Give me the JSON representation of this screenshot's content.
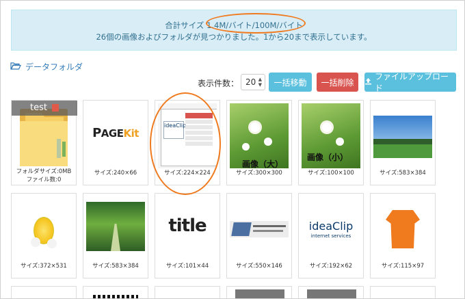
{
  "info": {
    "line1_prefix": "合計サイズ ",
    "line1_value": "1.4M/バイト/100M/バイト",
    "line2": "26個の画像およびフォルダが見つかりました。1から20まで表示しています。"
  },
  "breadcrumb": {
    "label": "データフォルダ"
  },
  "controls": {
    "page_size_label": "表示件数：",
    "page_size_value": "20",
    "move_button": "一括移動",
    "delete_button": "一括削除",
    "upload_button": "ファイルアップロード"
  },
  "colors": {
    "accent": "#5bc0de",
    "danger": "#d9534f",
    "highlight": "#f07a1e",
    "info_bg": "#d9edf7"
  },
  "folder": {
    "name": "test",
    "size_caption": "フォルダサイズ:0MB",
    "count_caption": "ファイル数:0"
  },
  "tiles": [
    {
      "caption": "サイズ:240×66",
      "logo_text_a": "P",
      "logo_text_b": "AGE",
      "logo_text_c": "Kit"
    },
    {
      "caption": "サイズ:224×224",
      "brand": "ideaClip",
      "brand_sub": "internet services"
    },
    {
      "caption": "サイズ:300×300",
      "overlay": "画像（大）"
    },
    {
      "caption": "サイズ:100×100",
      "overlay": "画像（小）"
    },
    {
      "caption": "サイズ:583×384"
    },
    {
      "caption": "サイズ:372×531"
    },
    {
      "caption": "サイズ:583×384"
    },
    {
      "caption": "サイズ:101×44",
      "word": "title"
    },
    {
      "caption": "サイズ:550×146"
    },
    {
      "caption": "サイズ:192×62",
      "brand": "ideaClip",
      "brand_sub": "internet services"
    },
    {
      "caption": "サイズ:115×97"
    }
  ]
}
